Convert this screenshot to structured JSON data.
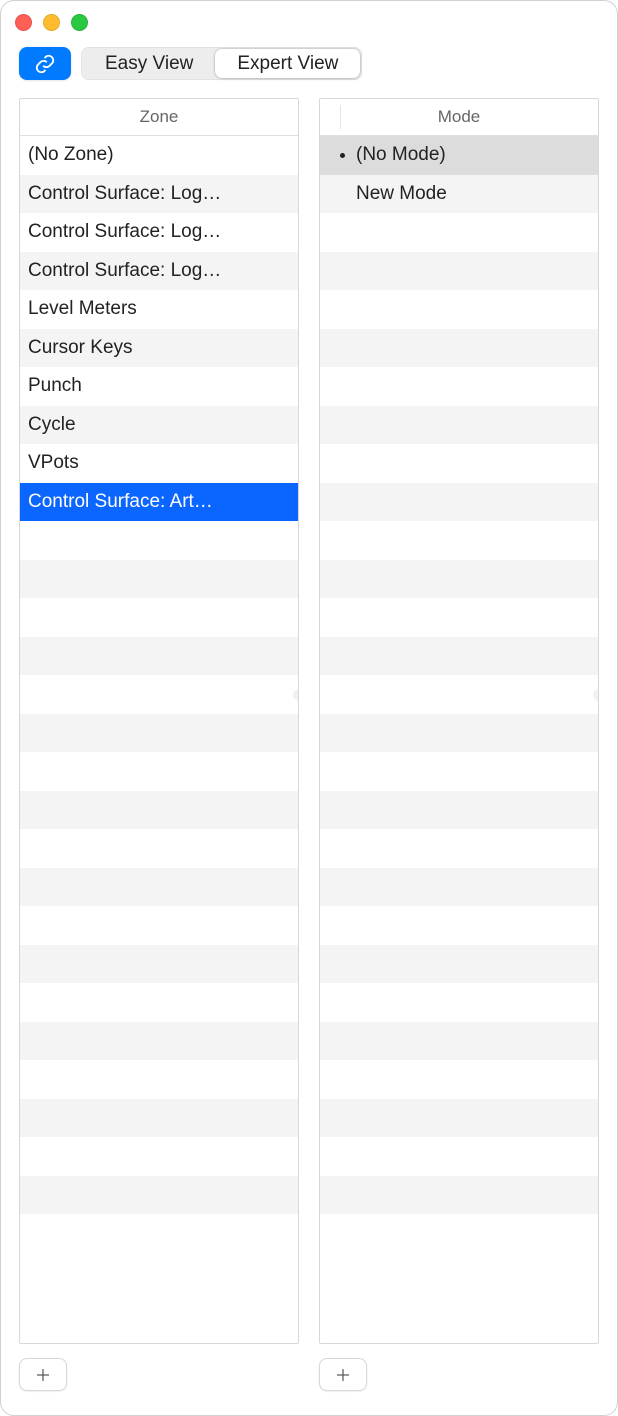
{
  "toolbar": {
    "tabs": {
      "easy": "Easy View",
      "expert": "Expert View"
    }
  },
  "zone": {
    "header": "Zone",
    "items": [
      "(No Zone)",
      "Control Surface: Log…",
      "Control Surface: Log…",
      "Control Surface: Log…",
      "Level Meters",
      "Cursor Keys",
      "Punch",
      "Cycle",
      "VPots",
      "Control Surface: Art…"
    ],
    "selectedIndex": 9
  },
  "mode": {
    "header": "Mode",
    "items": [
      "(No Mode)",
      "New Mode"
    ],
    "selectedIndex": 0,
    "bulletIndex": 0
  },
  "totalRows": 29
}
